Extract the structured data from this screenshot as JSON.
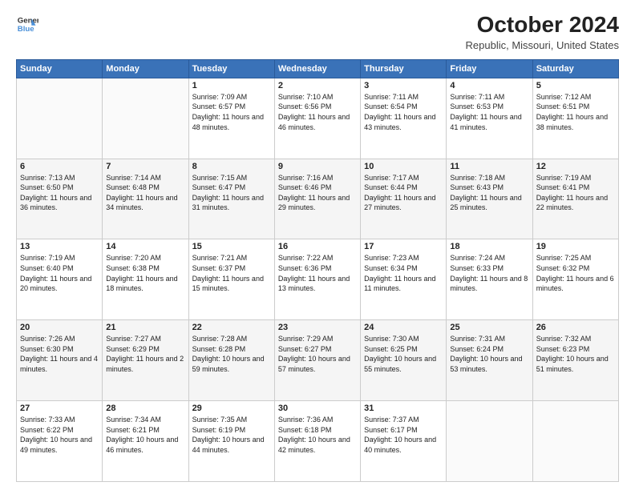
{
  "logo": {
    "line1": "General",
    "line2": "Blue"
  },
  "title": "October 2024",
  "subtitle": "Republic, Missouri, United States",
  "headers": [
    "Sunday",
    "Monday",
    "Tuesday",
    "Wednesday",
    "Thursday",
    "Friday",
    "Saturday"
  ],
  "weeks": [
    [
      {
        "day": "",
        "sunrise": "",
        "sunset": "",
        "daylight": ""
      },
      {
        "day": "",
        "sunrise": "",
        "sunset": "",
        "daylight": ""
      },
      {
        "day": "1",
        "sunrise": "Sunrise: 7:09 AM",
        "sunset": "Sunset: 6:57 PM",
        "daylight": "Daylight: 11 hours and 48 minutes."
      },
      {
        "day": "2",
        "sunrise": "Sunrise: 7:10 AM",
        "sunset": "Sunset: 6:56 PM",
        "daylight": "Daylight: 11 hours and 46 minutes."
      },
      {
        "day": "3",
        "sunrise": "Sunrise: 7:11 AM",
        "sunset": "Sunset: 6:54 PM",
        "daylight": "Daylight: 11 hours and 43 minutes."
      },
      {
        "day": "4",
        "sunrise": "Sunrise: 7:11 AM",
        "sunset": "Sunset: 6:53 PM",
        "daylight": "Daylight: 11 hours and 41 minutes."
      },
      {
        "day": "5",
        "sunrise": "Sunrise: 7:12 AM",
        "sunset": "Sunset: 6:51 PM",
        "daylight": "Daylight: 11 hours and 38 minutes."
      }
    ],
    [
      {
        "day": "6",
        "sunrise": "Sunrise: 7:13 AM",
        "sunset": "Sunset: 6:50 PM",
        "daylight": "Daylight: 11 hours and 36 minutes."
      },
      {
        "day": "7",
        "sunrise": "Sunrise: 7:14 AM",
        "sunset": "Sunset: 6:48 PM",
        "daylight": "Daylight: 11 hours and 34 minutes."
      },
      {
        "day": "8",
        "sunrise": "Sunrise: 7:15 AM",
        "sunset": "Sunset: 6:47 PM",
        "daylight": "Daylight: 11 hours and 31 minutes."
      },
      {
        "day": "9",
        "sunrise": "Sunrise: 7:16 AM",
        "sunset": "Sunset: 6:46 PM",
        "daylight": "Daylight: 11 hours and 29 minutes."
      },
      {
        "day": "10",
        "sunrise": "Sunrise: 7:17 AM",
        "sunset": "Sunset: 6:44 PM",
        "daylight": "Daylight: 11 hours and 27 minutes."
      },
      {
        "day": "11",
        "sunrise": "Sunrise: 7:18 AM",
        "sunset": "Sunset: 6:43 PM",
        "daylight": "Daylight: 11 hours and 25 minutes."
      },
      {
        "day": "12",
        "sunrise": "Sunrise: 7:19 AM",
        "sunset": "Sunset: 6:41 PM",
        "daylight": "Daylight: 11 hours and 22 minutes."
      }
    ],
    [
      {
        "day": "13",
        "sunrise": "Sunrise: 7:19 AM",
        "sunset": "Sunset: 6:40 PM",
        "daylight": "Daylight: 11 hours and 20 minutes."
      },
      {
        "day": "14",
        "sunrise": "Sunrise: 7:20 AM",
        "sunset": "Sunset: 6:38 PM",
        "daylight": "Daylight: 11 hours and 18 minutes."
      },
      {
        "day": "15",
        "sunrise": "Sunrise: 7:21 AM",
        "sunset": "Sunset: 6:37 PM",
        "daylight": "Daylight: 11 hours and 15 minutes."
      },
      {
        "day": "16",
        "sunrise": "Sunrise: 7:22 AM",
        "sunset": "Sunset: 6:36 PM",
        "daylight": "Daylight: 11 hours and 13 minutes."
      },
      {
        "day": "17",
        "sunrise": "Sunrise: 7:23 AM",
        "sunset": "Sunset: 6:34 PM",
        "daylight": "Daylight: 11 hours and 11 minutes."
      },
      {
        "day": "18",
        "sunrise": "Sunrise: 7:24 AM",
        "sunset": "Sunset: 6:33 PM",
        "daylight": "Daylight: 11 hours and 8 minutes."
      },
      {
        "day": "19",
        "sunrise": "Sunrise: 7:25 AM",
        "sunset": "Sunset: 6:32 PM",
        "daylight": "Daylight: 11 hours and 6 minutes."
      }
    ],
    [
      {
        "day": "20",
        "sunrise": "Sunrise: 7:26 AM",
        "sunset": "Sunset: 6:30 PM",
        "daylight": "Daylight: 11 hours and 4 minutes."
      },
      {
        "day": "21",
        "sunrise": "Sunrise: 7:27 AM",
        "sunset": "Sunset: 6:29 PM",
        "daylight": "Daylight: 11 hours and 2 minutes."
      },
      {
        "day": "22",
        "sunrise": "Sunrise: 7:28 AM",
        "sunset": "Sunset: 6:28 PM",
        "daylight": "Daylight: 10 hours and 59 minutes."
      },
      {
        "day": "23",
        "sunrise": "Sunrise: 7:29 AM",
        "sunset": "Sunset: 6:27 PM",
        "daylight": "Daylight: 10 hours and 57 minutes."
      },
      {
        "day": "24",
        "sunrise": "Sunrise: 7:30 AM",
        "sunset": "Sunset: 6:25 PM",
        "daylight": "Daylight: 10 hours and 55 minutes."
      },
      {
        "day": "25",
        "sunrise": "Sunrise: 7:31 AM",
        "sunset": "Sunset: 6:24 PM",
        "daylight": "Daylight: 10 hours and 53 minutes."
      },
      {
        "day": "26",
        "sunrise": "Sunrise: 7:32 AM",
        "sunset": "Sunset: 6:23 PM",
        "daylight": "Daylight: 10 hours and 51 minutes."
      }
    ],
    [
      {
        "day": "27",
        "sunrise": "Sunrise: 7:33 AM",
        "sunset": "Sunset: 6:22 PM",
        "daylight": "Daylight: 10 hours and 49 minutes."
      },
      {
        "day": "28",
        "sunrise": "Sunrise: 7:34 AM",
        "sunset": "Sunset: 6:21 PM",
        "daylight": "Daylight: 10 hours and 46 minutes."
      },
      {
        "day": "29",
        "sunrise": "Sunrise: 7:35 AM",
        "sunset": "Sunset: 6:19 PM",
        "daylight": "Daylight: 10 hours and 44 minutes."
      },
      {
        "day": "30",
        "sunrise": "Sunrise: 7:36 AM",
        "sunset": "Sunset: 6:18 PM",
        "daylight": "Daylight: 10 hours and 42 minutes."
      },
      {
        "day": "31",
        "sunrise": "Sunrise: 7:37 AM",
        "sunset": "Sunset: 6:17 PM",
        "daylight": "Daylight: 10 hours and 40 minutes."
      },
      {
        "day": "",
        "sunrise": "",
        "sunset": "",
        "daylight": ""
      },
      {
        "day": "",
        "sunrise": "",
        "sunset": "",
        "daylight": ""
      }
    ]
  ]
}
